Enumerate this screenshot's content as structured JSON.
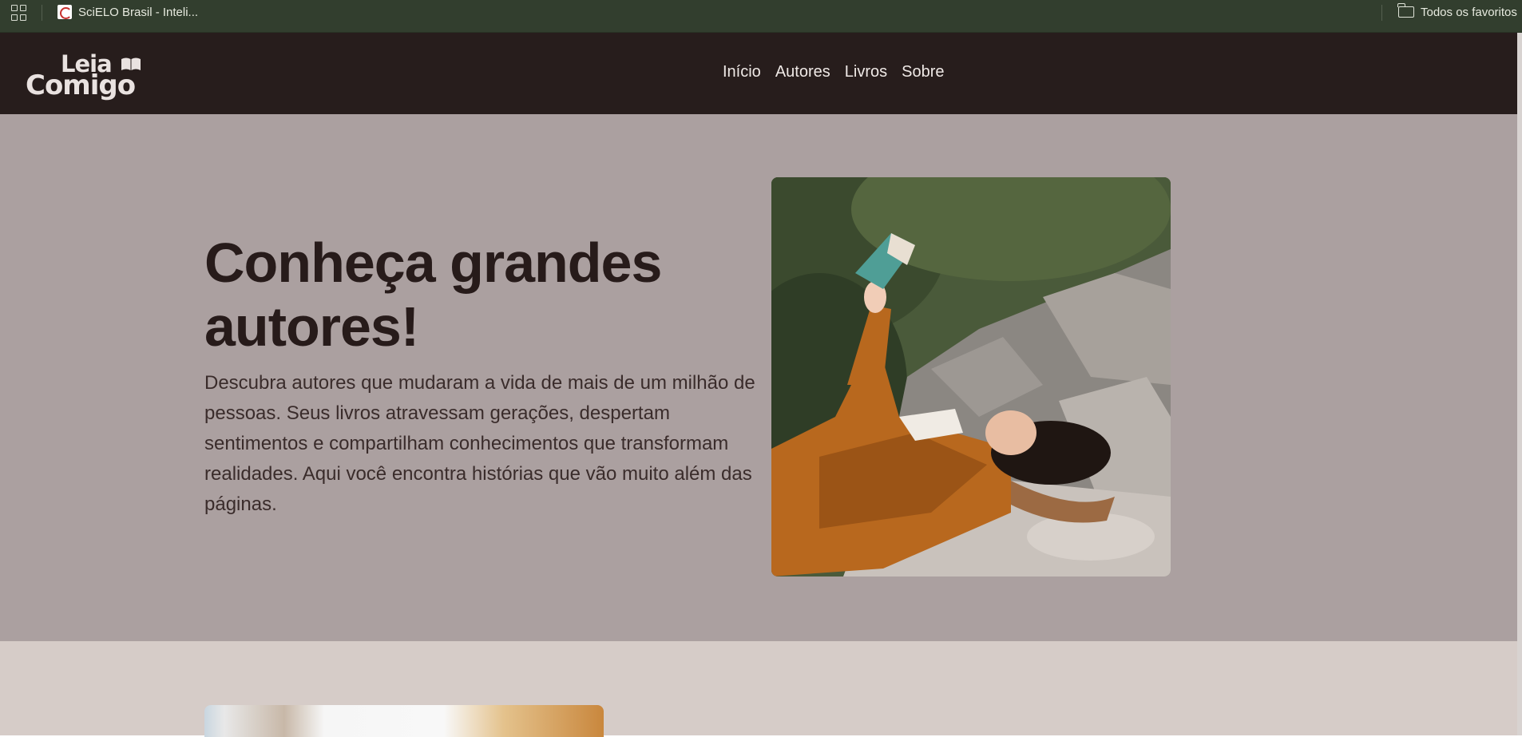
{
  "browser": {
    "bookmarks": [
      {
        "label": "SciELO Brasil - Inteli...",
        "icon": "scielo-favicon"
      },
      {
        "label": "Todos os favoritos",
        "icon": "folder-icon"
      }
    ]
  },
  "site": {
    "logo": {
      "line1": "Leia",
      "line2": "Comigo"
    },
    "nav": [
      "Início",
      "Autores",
      "Livros",
      "Sobre"
    ]
  },
  "hero": {
    "title": "Conheça grandes autores!",
    "text": "Descubra autores que mudaram a vida de mais de um milhão de pessoas. Seus livros atravessam gerações, despertam sentimentos e compartilham conhecimentos que transformam realidades. Aqui você encontra histórias que vão muito além das páginas.",
    "image_alt": "woman reading a book lying on rocks"
  },
  "colors": {
    "bookmarks_bar": "#323e2e",
    "header": "#271d1c",
    "hero_bg": "#aba0a0",
    "next_section_bg": "#d6ccc8",
    "title_text": "#271b1a"
  }
}
